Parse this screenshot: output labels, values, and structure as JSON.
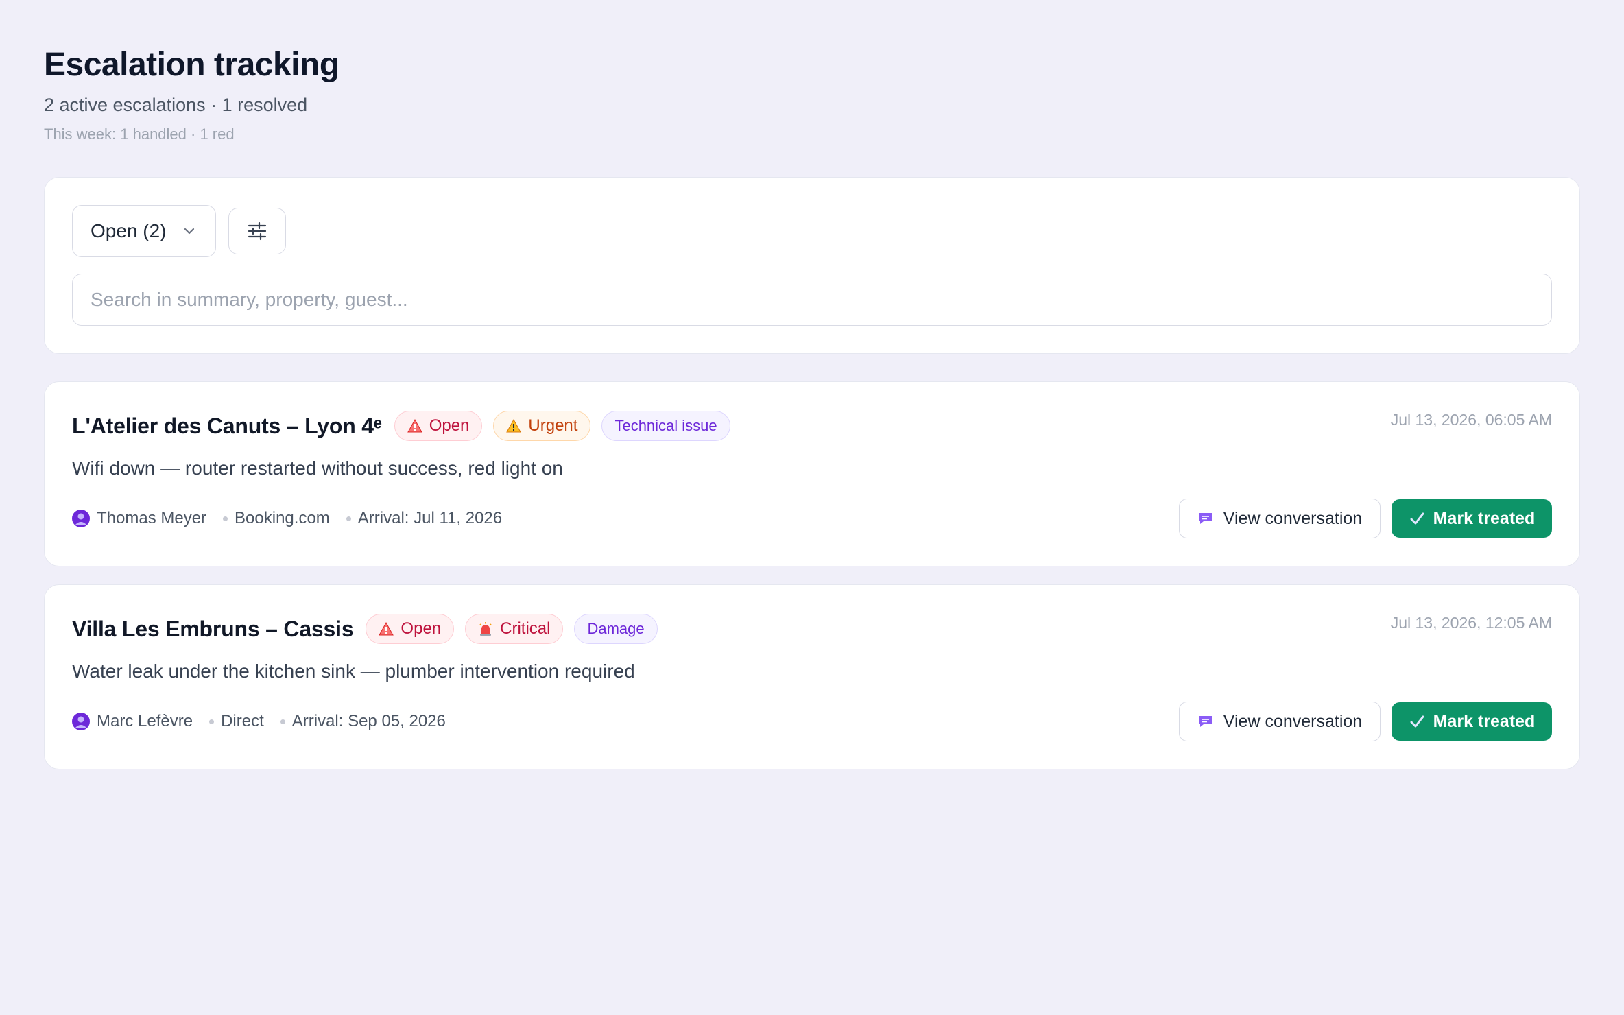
{
  "header": {
    "title": "Escalation tracking",
    "summary": "2 active escalations · 1 resolved",
    "week": "This week: 1 handled · 1 red"
  },
  "filters": {
    "status_label": "Open (2)",
    "filter_icon": "sliders-icon",
    "search_placeholder": "Search in summary, property, guest...",
    "search_value": ""
  },
  "escalations": [
    {
      "property": "L'Atelier des Canuts – Lyon 4ᵉ",
      "status": "Open",
      "priority": "Urgent",
      "priority_icon": "warning-icon",
      "category": "Technical issue",
      "timestamp": "Jul 13, 2026, 06:05 AM",
      "summary": "Wifi down — router restarted without success, red light on",
      "guest": "Thomas Meyer",
      "channel": "Booking.com",
      "arrival": "Arrival: Jul 11, 2026",
      "view_label": "View conversation",
      "mark_label": "Mark treated"
    },
    {
      "property": "Villa Les Embruns – Cassis",
      "status": "Open",
      "priority": "Critical",
      "priority_icon": "siren-icon",
      "category": "Damage",
      "timestamp": "Jul 13, 2026, 12:05 AM",
      "summary": "Water leak under the kitchen sink — plumber intervention required",
      "guest": "Marc Lefèvre",
      "channel": "Direct",
      "arrival": "Arrival: Sep 05, 2026",
      "view_label": "View conversation",
      "mark_label": "Mark treated"
    }
  ],
  "colors": {
    "background": "#f0eff9",
    "accent_green": "#0d9468",
    "open_red": "#be123c",
    "urgent_orange": "#c2410c",
    "category_purple": "#6d28d9"
  }
}
